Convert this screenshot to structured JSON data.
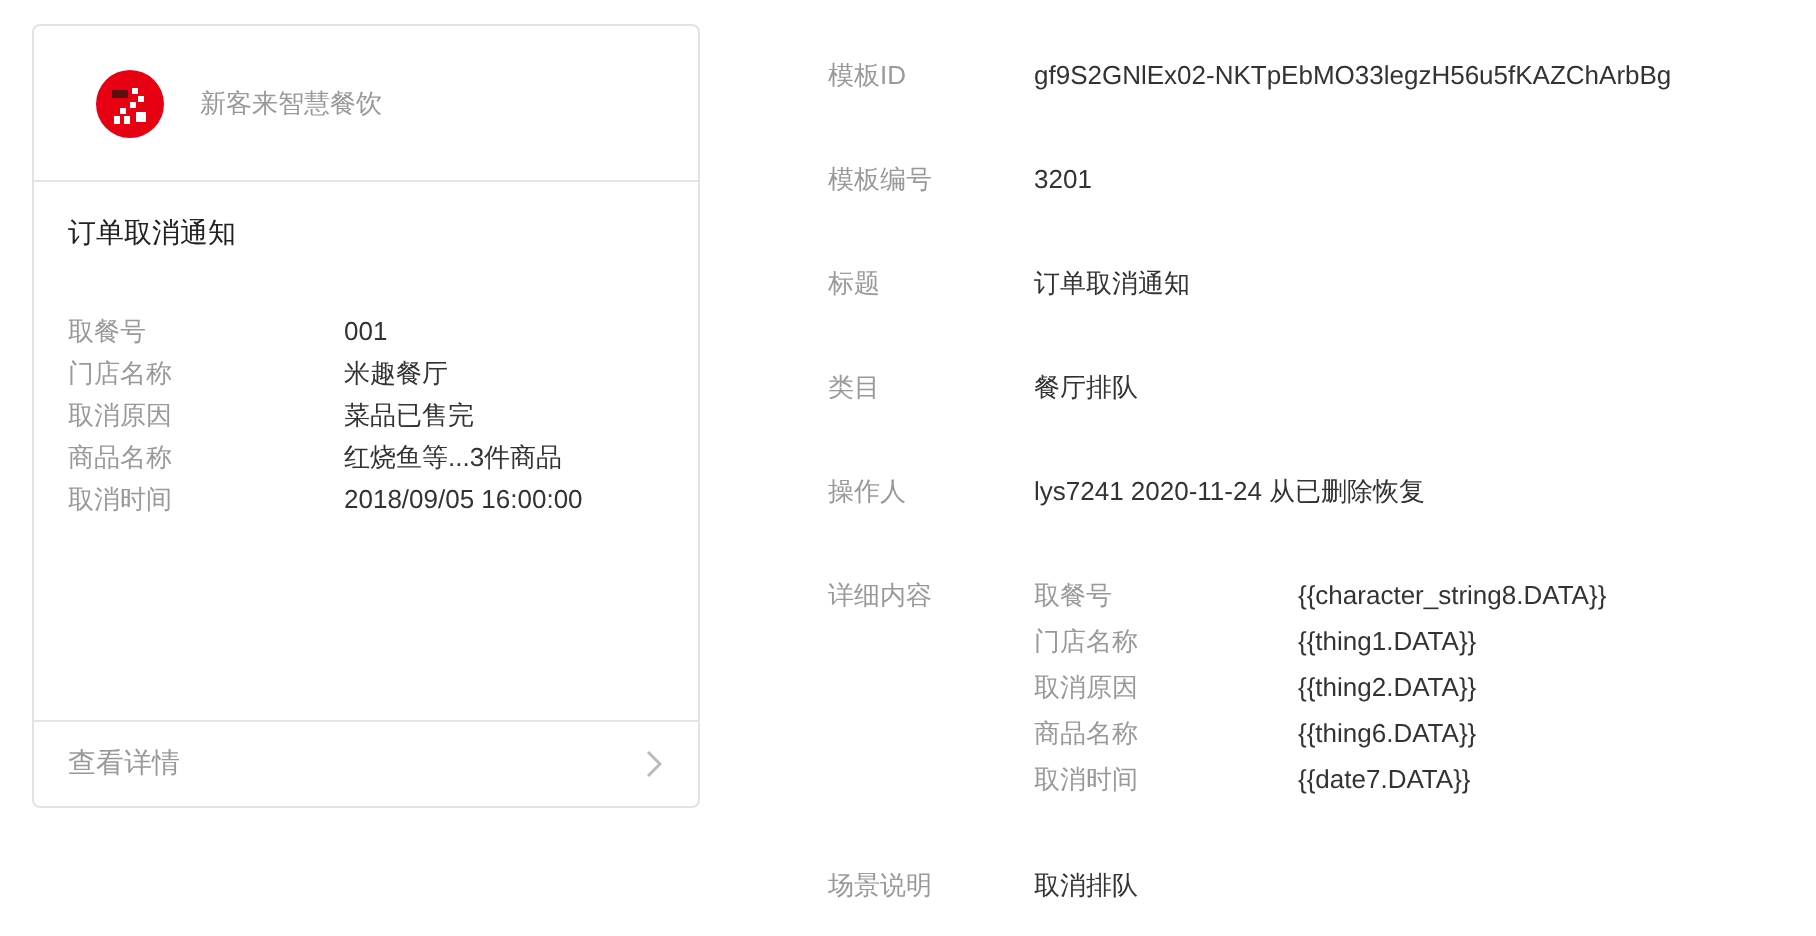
{
  "card": {
    "brand": "新客来智慧餐饮",
    "title": "订单取消通知",
    "fields": [
      {
        "label": "取餐号",
        "value": "001"
      },
      {
        "label": "门店名称",
        "value": "米趣餐厅"
      },
      {
        "label": "取消原因",
        "value": "菜品已售完"
      },
      {
        "label": "商品名称",
        "value": "红烧鱼等...3件商品"
      },
      {
        "label": "取消时间",
        "value": "2018/09/05 16:00:00"
      }
    ],
    "footer": "查看详情"
  },
  "info": [
    {
      "kind": "text",
      "label": "模板ID",
      "value": "gf9S2GNlEx02-NKTpEbMO33legzH56u5fKAZChArbBg"
    },
    {
      "kind": "text",
      "label": "模板编号",
      "value": "3201"
    },
    {
      "kind": "text",
      "label": "标题",
      "value": "订单取消通知"
    },
    {
      "kind": "text",
      "label": "类目",
      "value": "餐厅排队"
    },
    {
      "kind": "text",
      "label": "操作人",
      "value": "lys7241 2020-11-24 从已删除恢复"
    },
    {
      "kind": "fields",
      "label": "详细内容",
      "fields": [
        {
          "label": "取餐号",
          "value": "{{character_string8.DATA}}"
        },
        {
          "label": "门店名称",
          "value": "{{thing1.DATA}}"
        },
        {
          "label": "取消原因",
          "value": "{{thing2.DATA}}"
        },
        {
          "label": "商品名称",
          "value": "{{thing6.DATA}}"
        },
        {
          "label": "取消时间",
          "value": "{{date7.DATA}}"
        }
      ]
    },
    {
      "kind": "text",
      "label": "场景说明",
      "value": "取消排队"
    }
  ]
}
